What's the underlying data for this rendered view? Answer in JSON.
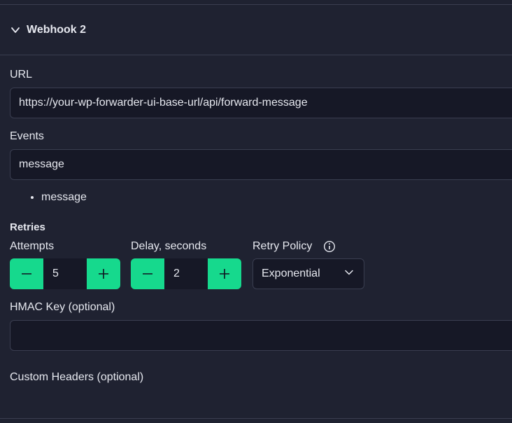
{
  "panel": {
    "title": "Webhook 2",
    "expanded": true
  },
  "url_field": {
    "label": "URL",
    "value": "https://your-wp-forwarder-ui-base-url/api/forward-message"
  },
  "events_field": {
    "label": "Events",
    "value": "message",
    "selected": [
      "message"
    ]
  },
  "retries": {
    "title": "Retries",
    "attempts": {
      "label": "Attempts",
      "value": "5"
    },
    "delay": {
      "label": "Delay, seconds",
      "value": "2"
    },
    "policy": {
      "label": "Retry Policy",
      "value": "Exponential"
    }
  },
  "hmac_field": {
    "label": "HMAC Key (optional)",
    "value": ""
  },
  "custom_headers": {
    "label": "Custom Headers (optional)"
  },
  "icons": {
    "collapse": "chevron-down-icon",
    "decrement": "minus-icon",
    "increment": "plus-icon",
    "info": "info-icon",
    "dropdown": "chevron-down-icon"
  },
  "colors": {
    "background": "#1f2231",
    "input_background": "#161826",
    "border": "#3a3e50",
    "accent": "#16d98d",
    "text": "#e6e8ef"
  }
}
